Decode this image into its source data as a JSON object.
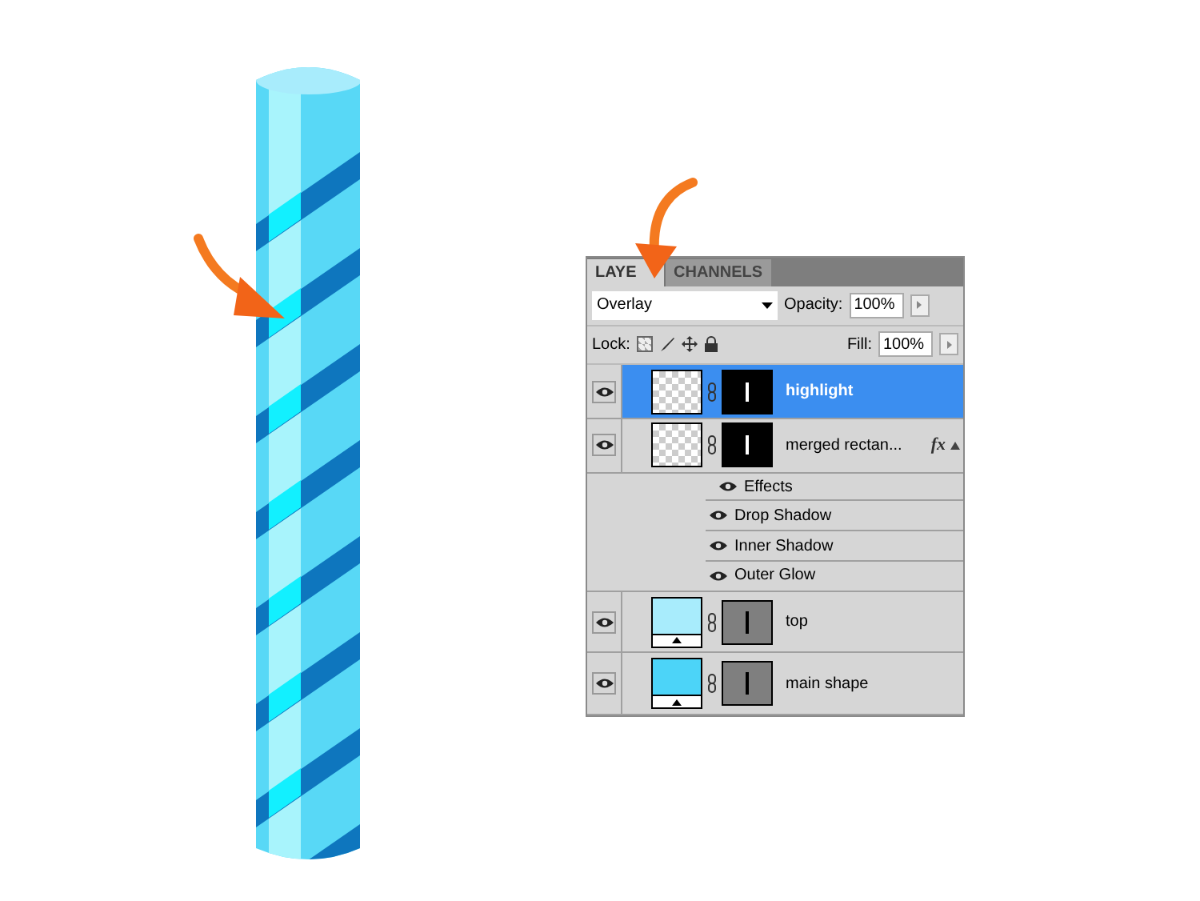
{
  "tabs": [
    {
      "label": "LAYE",
      "selected": true
    },
    {
      "label": "CHANNELS",
      "selected": false
    }
  ],
  "blend_mode": {
    "value": "Overlay"
  },
  "opacity": {
    "label": "Opacity:",
    "value": "100%"
  },
  "lock": {
    "label": "Lock:"
  },
  "fill": {
    "label": "Fill:",
    "value": "100%"
  },
  "layers": [
    {
      "kind": "pixel",
      "name": "highlight",
      "selected": true
    },
    {
      "kind": "pixel",
      "name": "merged rectan...",
      "selected": false,
      "fx": "fx",
      "children": [
        {
          "name": "Effects",
          "children": [
            {
              "name": "Drop Shadow"
            },
            {
              "name": "Inner Shadow"
            },
            {
              "name": "Outer Glow"
            }
          ]
        }
      ]
    },
    {
      "kind": "shape",
      "name": "top",
      "selected": false,
      "color": "#a8ecfc"
    },
    {
      "kind": "shape",
      "name": "main shape",
      "selected": false,
      "color": "#4cd4f8"
    }
  ]
}
